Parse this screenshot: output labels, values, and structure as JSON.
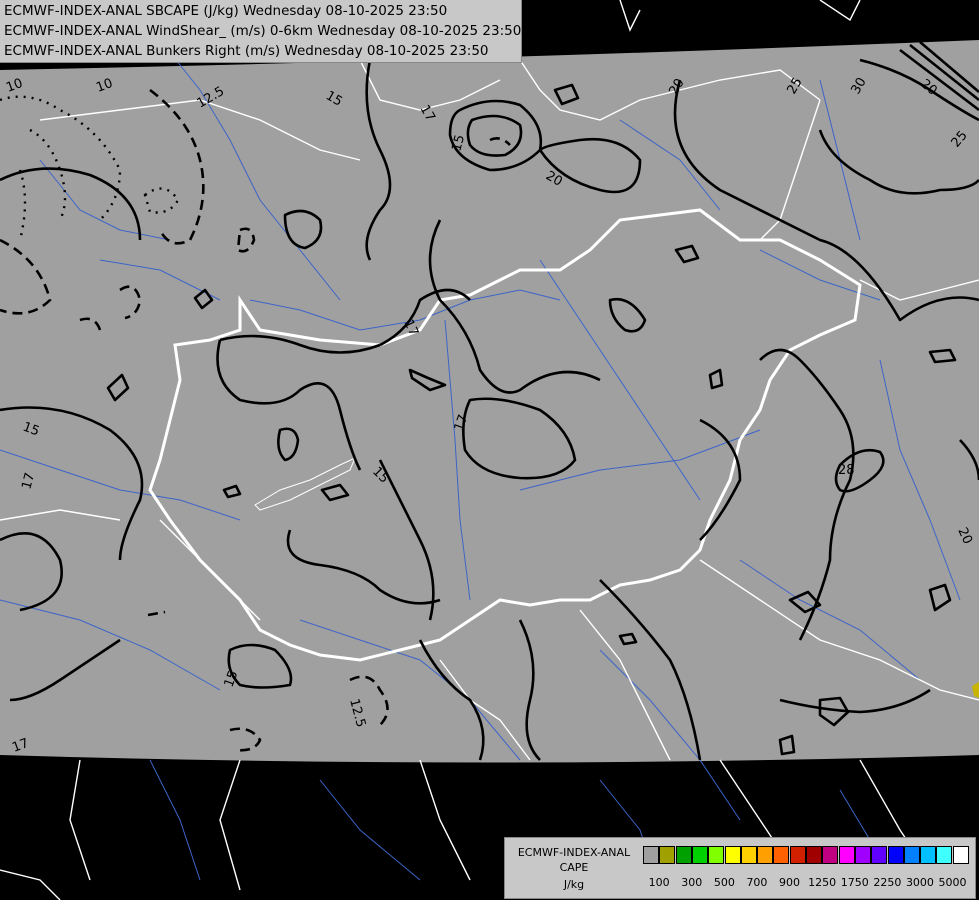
{
  "header": {
    "line1": "ECMWF-INDEX-ANAL SBCAPE (J/kg) Wednesday 08-10-2025 23:50",
    "line2": "ECMWF-INDEX-ANAL WindShear_ (m/s) 0-6km Wednesday 08-10-2025 23:50",
    "line3": "ECMWF-INDEX-ANAL Bunkers Right (m/s) Wednesday 08-10-2025 23:50"
  },
  "contour_labels": [
    "10",
    "10",
    "12.5",
    "15",
    "17",
    "15",
    "20",
    "20",
    "25",
    "30",
    "20",
    "25",
    "17",
    "15",
    "17",
    "17",
    "15",
    "28",
    "20",
    "15",
    "12.5",
    "17"
  ],
  "legend": {
    "title_line1": "ECMWF-INDEX-ANAL",
    "title_line2": "CAPE",
    "title_line3": "J/kg",
    "tick_labels": [
      "100",
      "300",
      "500",
      "700",
      "900",
      "1250",
      "1750",
      "2250",
      "3000",
      "5000"
    ],
    "colors": [
      "#a0a0a0",
      "#a0a000",
      "#00a000",
      "#00d000",
      "#80ff00",
      "#ffff00",
      "#ffd000",
      "#ffa000",
      "#ff6000",
      "#d02000",
      "#a00000",
      "#c00080",
      "#ff00ff",
      "#a000ff",
      "#6000ff",
      "#0000ff",
      "#0080ff",
      "#00c0ff",
      "#40ffff",
      "#ffffff"
    ]
  },
  "theme": {
    "field": "#a0a0a0",
    "outside": "#000000",
    "border": "#ffffff",
    "river": "#3c64c8"
  }
}
